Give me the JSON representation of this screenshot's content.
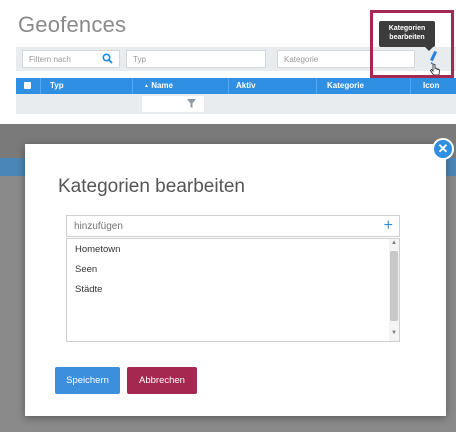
{
  "page": {
    "title": "Geofences"
  },
  "filters": {
    "filter_placeholder": "Filtern nach",
    "typ_placeholder": "Typ",
    "kategorie_placeholder": "Kategorie"
  },
  "tooltip": {
    "line1": "Kategorien",
    "line2": "bearbeiten"
  },
  "table": {
    "columns": [
      "Typ",
      "Name",
      "Aktiv",
      "Kategorie",
      "Icon"
    ],
    "sort_indicator": "▲"
  },
  "modal": {
    "title": "Kategorien bearbeiten",
    "add_placeholder": "hinzufügen",
    "categories": [
      "Hometown",
      "Seen",
      "Städte"
    ],
    "save_label": "Speichern",
    "cancel_label": "Abbrechen"
  },
  "colors": {
    "accent": "#2e8fe3",
    "danger": "#a4284f",
    "highlight": "#a4284f"
  },
  "icons": [
    "search-icon",
    "pencil-icon",
    "hand-cursor-icon",
    "funnel-icon",
    "close-icon",
    "plus-icon",
    "checkbox-icon"
  ]
}
